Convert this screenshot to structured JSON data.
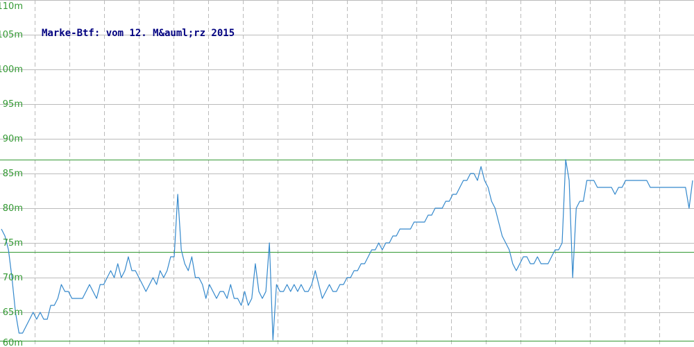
{
  "chart_data": {
    "type": "line",
    "title": "Marke-Btf: vom 12. M&auml;rz 2015",
    "xlabel": "",
    "ylabel": "",
    "ylim": [
      60,
      110
    ],
    "yticks": [
      {
        "value": 60,
        "label": "60m"
      },
      {
        "value": 65,
        "label": "65m"
      },
      {
        "value": 70,
        "label": "70m"
      },
      {
        "value": 75,
        "label": "75m"
      },
      {
        "value": 80,
        "label": "80m"
      },
      {
        "value": 85,
        "label": "85m"
      },
      {
        "value": 90,
        "label": "90m"
      },
      {
        "value": 95,
        "label": "95m"
      },
      {
        "value": 100,
        "label": "100m"
      },
      {
        "value": 105,
        "label": "105m"
      },
      {
        "value": 110,
        "label": "110m"
      }
    ],
    "grid": true,
    "reference_lines": [
      87,
      73.7,
      60.9
    ],
    "series": [
      {
        "values": [
          77,
          76,
          74,
          70,
          65,
          62,
          62,
          63,
          64,
          65,
          64,
          65,
          64,
          64,
          66,
          66,
          67,
          69,
          68,
          68,
          67,
          67,
          67,
          67,
          68,
          69,
          68,
          67,
          69,
          69,
          70,
          71,
          70,
          72,
          70,
          71,
          73,
          71,
          71,
          70,
          69,
          68,
          69,
          70,
          69,
          71,
          70,
          71,
          73,
          73,
          82,
          74,
          72,
          71,
          73,
          70,
          70,
          69,
          67,
          69,
          68,
          67,
          68,
          68,
          67,
          69,
          67,
          67,
          66,
          68,
          66,
          67,
          72,
          68,
          67,
          68,
          75,
          61,
          69,
          68,
          68,
          69,
          68,
          69,
          68,
          69,
          68,
          68,
          69,
          71,
          69,
          67,
          68,
          69,
          68,
          68,
          69,
          69,
          70,
          70,
          71,
          71,
          72,
          72,
          73,
          74,
          74,
          75,
          74,
          75,
          75,
          76,
          76,
          77,
          77,
          77,
          77,
          78,
          78,
          78,
          78,
          79,
          79,
          80,
          80,
          80,
          81,
          81,
          82,
          82,
          83,
          84,
          84,
          85,
          85,
          84,
          86,
          84,
          83,
          81,
          80,
          78,
          76,
          75,
          74,
          72,
          71,
          72,
          73,
          73,
          72,
          72,
          73,
          72,
          72,
          72,
          73,
          74,
          74,
          75,
          87,
          84,
          70,
          80,
          81,
          81,
          84,
          84,
          84,
          83,
          83,
          83,
          83,
          83,
          82,
          83,
          83,
          84,
          84,
          84,
          84,
          84,
          84,
          84,
          83,
          83,
          83,
          83,
          83,
          83,
          83,
          83,
          83,
          83,
          83,
          80,
          84
        ],
        "color": "#3388cc"
      }
    ]
  },
  "colors": {
    "line": "#3388cc",
    "grid": "#bbbbbb",
    "reference": "#339933",
    "tick_text": "#339933",
    "title_text": "#000080"
  }
}
